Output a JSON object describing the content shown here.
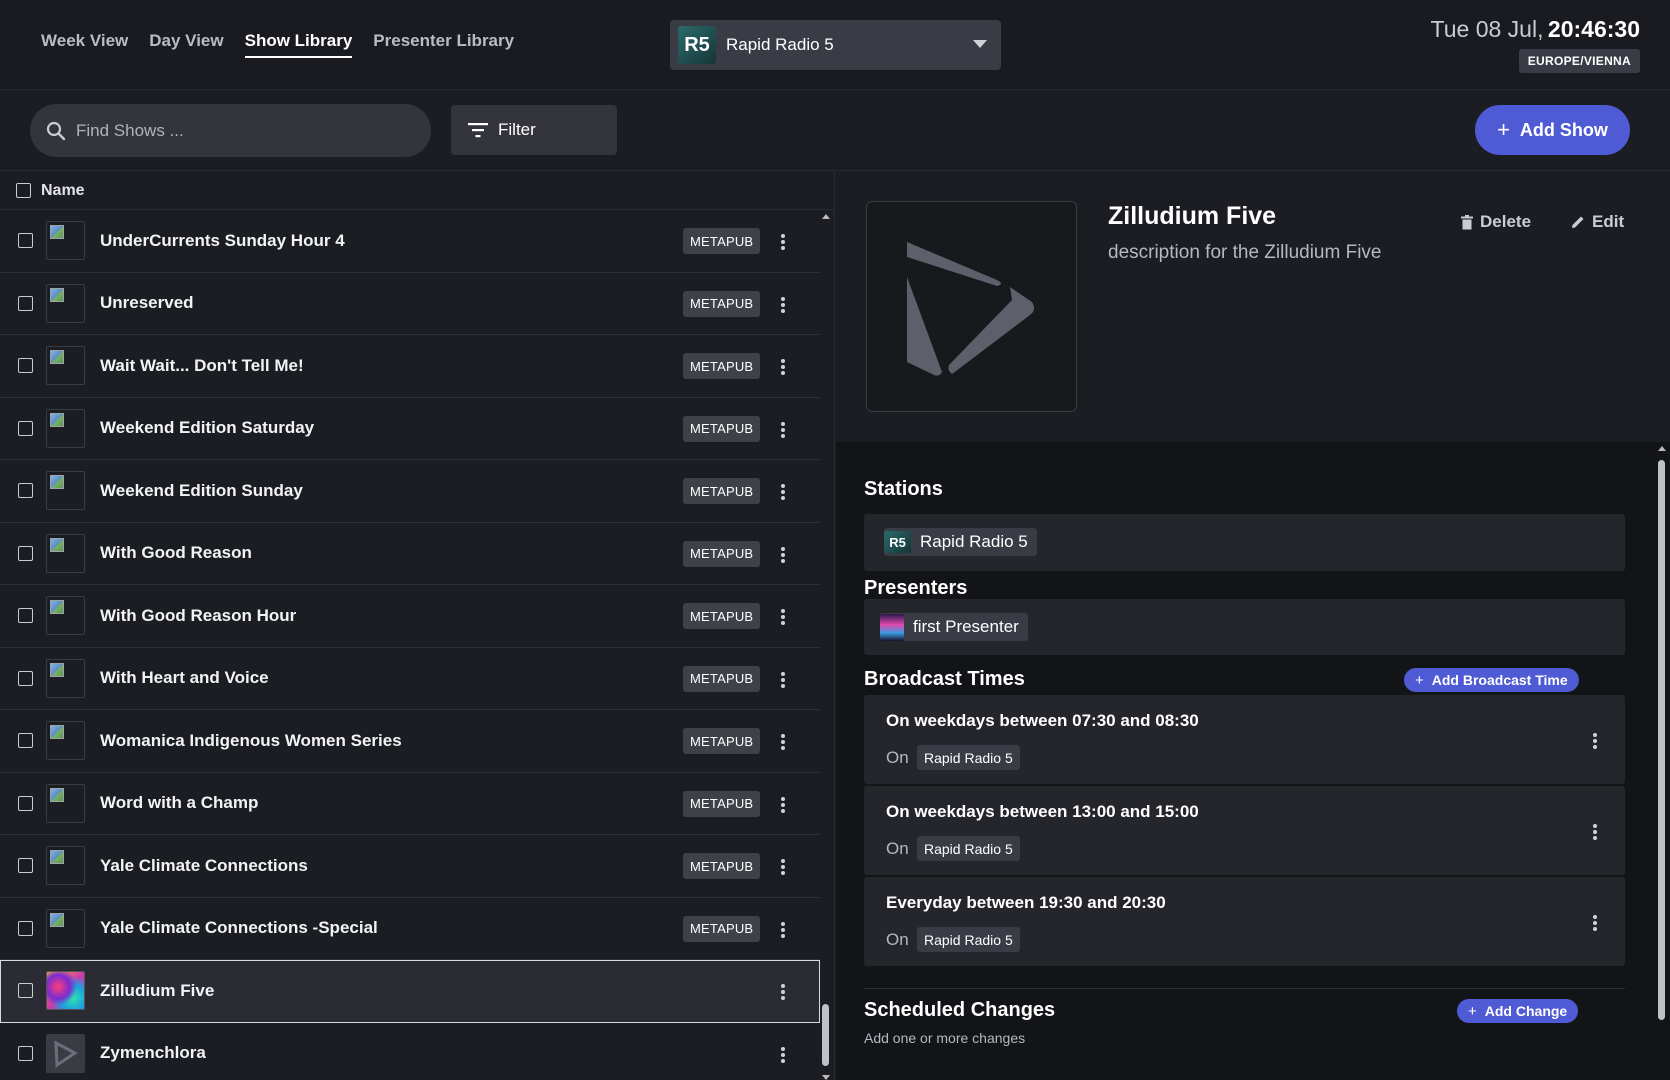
{
  "nav": {
    "tabs": [
      {
        "label": "Week View",
        "active": false
      },
      {
        "label": "Day View",
        "active": false
      },
      {
        "label": "Show Library",
        "active": true
      },
      {
        "label": "Presenter Library",
        "active": false
      }
    ]
  },
  "station_selector": {
    "logo": "R5",
    "name": "Rapid Radio 5",
    "icon": "chevron-down-icon"
  },
  "clock": {
    "date": "Tue 08 Jul,",
    "time": "20:46:30",
    "timezone": "EUROPE/VIENNA"
  },
  "toolbar": {
    "search_placeholder": "Find Shows ...",
    "filter_label": "Filter",
    "add_show_label": "Add Show"
  },
  "list": {
    "header": "Name",
    "rows": [
      {
        "name": "UnderCurrents Sunday Hour 4",
        "badge": "METAPUB",
        "thumb": "broken"
      },
      {
        "name": "Unreserved",
        "badge": "METAPUB",
        "thumb": "broken"
      },
      {
        "name": "Wait Wait... Don't Tell Me!",
        "badge": "METAPUB",
        "thumb": "broken"
      },
      {
        "name": "Weekend Edition Saturday",
        "badge": "METAPUB",
        "thumb": "broken"
      },
      {
        "name": "Weekend Edition Sunday",
        "badge": "METAPUB",
        "thumb": "broken"
      },
      {
        "name": "With Good Reason",
        "badge": "METAPUB",
        "thumb": "broken"
      },
      {
        "name": "With Good Reason Hour",
        "badge": "METAPUB",
        "thumb": "broken"
      },
      {
        "name": "With Heart and Voice",
        "badge": "METAPUB",
        "thumb": "broken"
      },
      {
        "name": "Womanica Indigenous Women Series",
        "badge": "METAPUB",
        "thumb": "broken"
      },
      {
        "name": "Word with a Champ",
        "badge": "METAPUB",
        "thumb": "broken"
      },
      {
        "name": "Yale Climate Connections",
        "badge": "METAPUB",
        "thumb": "broken"
      },
      {
        "name": "Yale Climate Connections -Special",
        "badge": "METAPUB",
        "thumb": "broken"
      },
      {
        "name": "Zilludium Five",
        "badge": "",
        "thumb": "colorful",
        "selected": true
      },
      {
        "name": "Zymenchlora",
        "badge": "",
        "thumb": "play"
      }
    ]
  },
  "detail": {
    "title": "Zilludium Five",
    "description": "description for the Zilludium Five",
    "delete_label": "Delete",
    "edit_label": "Edit",
    "stations_title": "Stations",
    "station_chip": {
      "logo": "R5",
      "name": "Rapid Radio 5"
    },
    "presenters_title": "Presenters",
    "presenter_chip": "first Presenter",
    "broadcast_title": "Broadcast Times",
    "add_broadcast_label": "Add Broadcast Time",
    "broadcast_times": [
      {
        "text": "On weekdays between 07:30 and 08:30",
        "on": "On",
        "station": "Rapid Radio 5"
      },
      {
        "text": "On weekdays between 13:00 and 15:00",
        "on": "On",
        "station": "Rapid Radio 5"
      },
      {
        "text": "Everyday between 19:30 and 20:30",
        "on": "On",
        "station": "Rapid Radio 5"
      }
    ],
    "scheduled_title": "Scheduled Changes",
    "add_change_label": "Add Change",
    "scheduled_hint": "Add one or more changes"
  },
  "colors": {
    "accent": "#4f5bd5",
    "background": "#1c1d22",
    "panel": "#25262c"
  }
}
